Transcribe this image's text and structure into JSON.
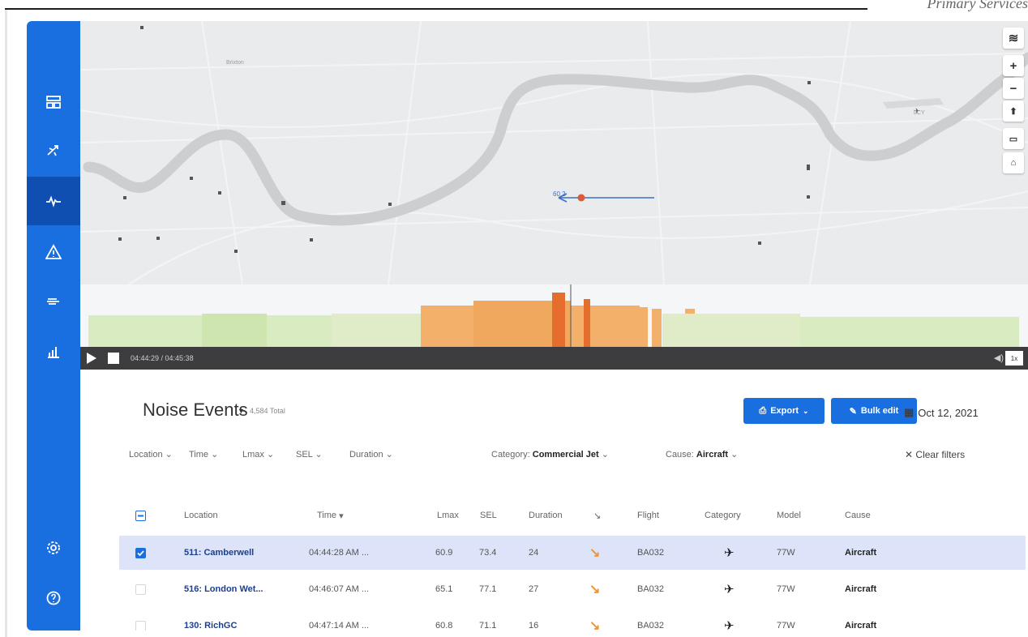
{
  "corner_text": "Primary Services",
  "map": {
    "marker_value": "60.2",
    "airport_code": "LCY",
    "place_label": "Brixton",
    "controls": [
      "layers-icon",
      "zoom-in",
      "zoom-out",
      "north-arrow-icon",
      "fullscreen-icon",
      "home-icon"
    ],
    "zoom_in_label": "+",
    "zoom_out_label": "−"
  },
  "playback": {
    "time": "04:44:29 / 04:45:38",
    "speed": "1x",
    "progress": 0.51
  },
  "sidebar": {
    "items": [
      "dashboard-icon",
      "flights-icon",
      "noise-icon",
      "alerts-icon",
      "weather-icon",
      "reports-icon",
      "settings-icon",
      "help-icon"
    ],
    "active": "noise-icon"
  },
  "header": {
    "title": "Noise Events",
    "total": "4,584 Total",
    "export_label": "Export",
    "bulk_edit_label": "Bulk edit",
    "date": "Oct 12, 2021"
  },
  "filters": {
    "location": "Location",
    "time": "Time",
    "lmax": "Lmax",
    "sel": "SEL",
    "duration": "Duration",
    "category_label": "Category:",
    "category_value": "Commercial Jet",
    "cause_label": "Cause:",
    "cause_value": "Aircraft",
    "clear": "Clear filters"
  },
  "table": {
    "columns": {
      "location": "Location",
      "time": "Time",
      "lmax": "Lmax",
      "sel": "SEL",
      "duration": "Duration",
      "flight": "Flight",
      "category": "Category",
      "model": "Model",
      "cause": "Cause"
    },
    "rows": [
      {
        "location": "511: Camberwell",
        "time": "04:44:28 AM ...",
        "lmax": "60.9",
        "sel": "73.4",
        "duration": "24",
        "flight": "BA032",
        "model": "77W",
        "cause": "Aircraft",
        "selected": true
      },
      {
        "location": "516: London Wet...",
        "time": "04:46:07 AM ...",
        "lmax": "65.1",
        "sel": "77.1",
        "duration": "27",
        "flight": "BA032",
        "model": "77W",
        "cause": "Aircraft",
        "selected": false
      },
      {
        "location": "130: RichGC",
        "time": "04:47:14 AM ...",
        "lmax": "60.8",
        "sel": "71.1",
        "duration": "16",
        "flight": "BA032",
        "model": "77W",
        "cause": "Aircraft",
        "selected": false
      }
    ]
  },
  "colors": {
    "accent": "#1a6fe0",
    "sidebar_active": "#0f4fb2",
    "selected_row": "#dde4fa",
    "noise_low": "#d9ebc1",
    "noise_mid": "#f2b06a",
    "noise_high": "#e56e2e"
  }
}
